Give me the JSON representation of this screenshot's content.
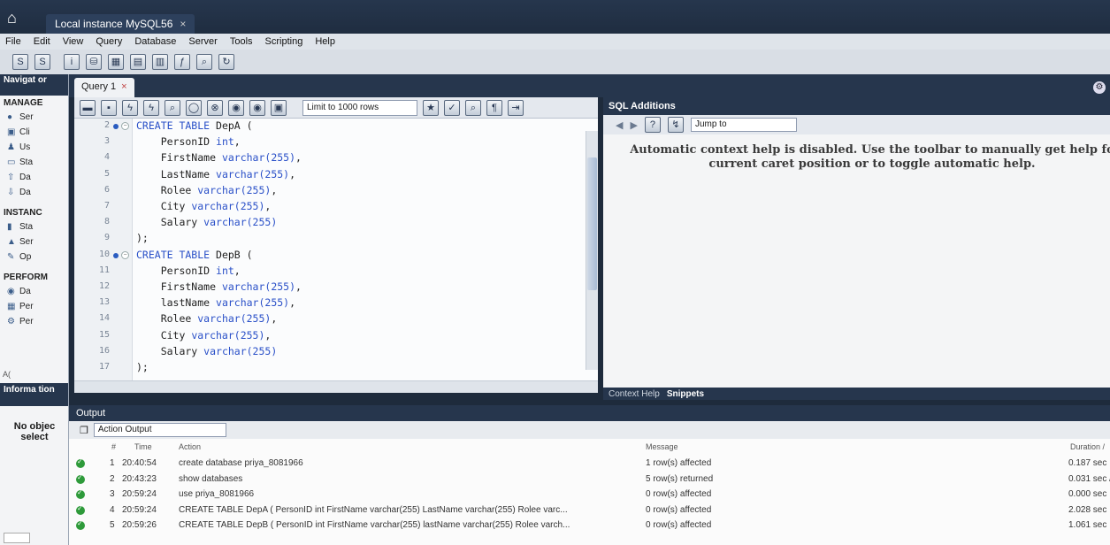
{
  "window": {
    "connection_tab": "Local instance MySQL56",
    "close": "×"
  },
  "menu": [
    "File",
    "Edit",
    "View",
    "Query",
    "Database",
    "Server",
    "Tools",
    "Scripting",
    "Help"
  ],
  "navigator": {
    "title": "Navigat or",
    "management": "MANAGE",
    "management_items": [
      "Ser",
      "Cli",
      "Us",
      "Sta",
      "Da",
      "Da"
    ],
    "instance": "INSTANC",
    "instance_items": [
      "Sta",
      "Ser",
      "Op"
    ],
    "performance": "PERFORM",
    "performance_items": [
      "Da",
      "Per",
      "Per"
    ],
    "tabs": "A(",
    "info_title": "Informa tion",
    "no_object": "No objec select"
  },
  "query_tab": {
    "label": "Query 1",
    "close": "×"
  },
  "editor_toolbar": {
    "limit": "Limit to 1000 rows"
  },
  "editor": {
    "lines": [
      {
        "n": "2",
        "marker": true,
        "fold": true,
        "text": "CREATE TABLE DepA (",
        "kw": "CREATE TABLE",
        "rest": " DepA ("
      },
      {
        "n": "3",
        "text": "    PersonID int,",
        "kw": "",
        "rest": "    PersonID int,"
      },
      {
        "n": "4",
        "text": "    FirstName varchar(255),",
        "pre": "    FirstName ",
        "type": "varchar(255)",
        "post": ","
      },
      {
        "n": "5",
        "pre": "    LastName ",
        "type": "varchar(255)",
        "post": ","
      },
      {
        "n": "6",
        "pre": "    Rolee ",
        "type": "varchar(255)",
        "post": ","
      },
      {
        "n": "7",
        "pre": "    City ",
        "type": "varchar(255)",
        "post": ","
      },
      {
        "n": "8",
        "pre": "    Salary ",
        "type": "varchar(255)",
        "post": ""
      },
      {
        "n": "9",
        "pre": ");",
        "type": "",
        "post": ""
      },
      {
        "n": "10",
        "marker": true,
        "fold": true,
        "pre": "",
        "type": "CREATE TABLE",
        "post": " DepB ("
      },
      {
        "n": "11",
        "pre": "    PersonID ",
        "type": "int",
        "post": ","
      },
      {
        "n": "12",
        "pre": "    FirstName ",
        "type": "varchar(255)",
        "post": ","
      },
      {
        "n": "13",
        "pre": "    lastName ",
        "type": "varchar(255)",
        "post": ","
      },
      {
        "n": "14",
        "pre": "    Rolee ",
        "type": "varchar(255)",
        "post": ","
      },
      {
        "n": "15",
        "pre": "    City ",
        "type": "varchar(255)",
        "post": ","
      },
      {
        "n": "16",
        "pre": "    Salary ",
        "type": "varchar(255)",
        "post": ""
      },
      {
        "n": "17",
        "pre": ");",
        "type": "",
        "post": ""
      }
    ]
  },
  "sql_additions": {
    "title": "SQL Additions",
    "jump_to": "Jump to",
    "help_line1": "Automatic context help is disabled. Use the toolbar to manually get help fo",
    "help_line2": "current caret position or to toggle automatic help.",
    "tab_context": "Context Help",
    "tab_snippets": "Snippets"
  },
  "output": {
    "title": "Output",
    "selector": "Action Output",
    "headers": {
      "num": "#",
      "time": "Time",
      "action": "Action",
      "message": "Message",
      "duration": "Duration /"
    },
    "rows": [
      {
        "num": "1",
        "time": "20:40:54",
        "action": "create database priya_8081966",
        "message": "1 row(s) affected",
        "duration": "0.187 sec"
      },
      {
        "num": "2",
        "time": "20:43:23",
        "action": "show databases",
        "message": "5 row(s) returned",
        "duration": "0.031 sec /"
      },
      {
        "num": "3",
        "time": "20:59:24",
        "action": "use priya_8081966",
        "message": "0 row(s) affected",
        "duration": "0.000 sec"
      },
      {
        "num": "4",
        "time": "20:59:24",
        "action": "CREATE TABLE DepA (    PersonID int      FirstName varchar(255)     LastName varchar(255)     Rolee varc...",
        "message": "0 row(s) affected",
        "duration": "2.028 sec"
      },
      {
        "num": "5",
        "time": "20:59:26",
        "action": "CREATE TABLE DepB (    PersonID int      FirstName varchar(255)     lastName varchar(255)     Rolee varch...",
        "message": "0 row(s) affected",
        "duration": "1.061 sec"
      }
    ]
  }
}
